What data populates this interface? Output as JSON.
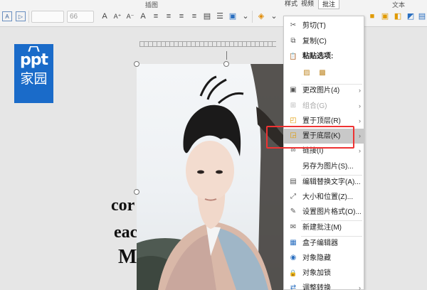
{
  "ribbon": {
    "group_label": "插图",
    "group_label_right": "文本",
    "tabs_partial": [
      "样式",
      "视频"
    ],
    "active_tab": "批注",
    "font_name_placeholder": "",
    "font_size_value": "66"
  },
  "logo": {
    "line1": "ppt",
    "line2": "家园"
  },
  "slide_text": {
    "line1": "cor",
    "line2": "eac",
    "line3": "M"
  },
  "menu": {
    "items": [
      {
        "label": "剪切(T)",
        "icon": "scissors-icon",
        "glyph": "✂"
      },
      {
        "label": "复制(C)",
        "icon": "copy-icon",
        "glyph": "⧉"
      },
      {
        "label": "粘贴选项:",
        "icon": "paste-icon",
        "glyph": "📋"
      },
      {
        "label": "更改图片(4)",
        "icon": "change-picture-icon",
        "glyph": "▣",
        "submenu": true
      },
      {
        "label": "组合(G)",
        "icon": "group-icon",
        "glyph": "⊞",
        "submenu": true,
        "disabled": true
      },
      {
        "label": "置于顶层(R)",
        "icon": "bring-front-icon",
        "glyph": "◰",
        "submenu": true
      },
      {
        "label": "置于底层(K)",
        "icon": "send-back-icon",
        "glyph": "◲",
        "submenu": true,
        "highlighted": true
      },
      {
        "label": "链接(I)",
        "icon": "link-icon",
        "glyph": "∞",
        "submenu": true
      },
      {
        "label": "另存为图片(S)...",
        "icon": "",
        "glyph": ""
      },
      {
        "label": "编辑替换文字(A)...",
        "icon": "alt-text-icon",
        "glyph": "▤"
      },
      {
        "label": "大小和位置(Z)...",
        "icon": "size-position-icon",
        "glyph": "⤢"
      },
      {
        "label": "设置图片格式(O)...",
        "icon": "format-picture-icon",
        "glyph": "✎"
      },
      {
        "label": "新建批注(M)",
        "icon": "comment-icon",
        "glyph": "✉"
      },
      {
        "label": "盒子编辑器",
        "icon": "box-editor-icon",
        "glyph": "▦"
      },
      {
        "label": "对象隐藏",
        "icon": "eye-hide-icon",
        "glyph": "◉"
      },
      {
        "label": "对象加锁",
        "icon": "lock-icon",
        "glyph": "🔒"
      },
      {
        "label": "调整转换",
        "icon": "convert-icon",
        "glyph": "⇄",
        "submenu": true
      }
    ]
  },
  "colors": {
    "logo_blue": "#1a6bc9",
    "highlight_red": "#e33333",
    "menu_highlight": "#c8c8c8"
  }
}
